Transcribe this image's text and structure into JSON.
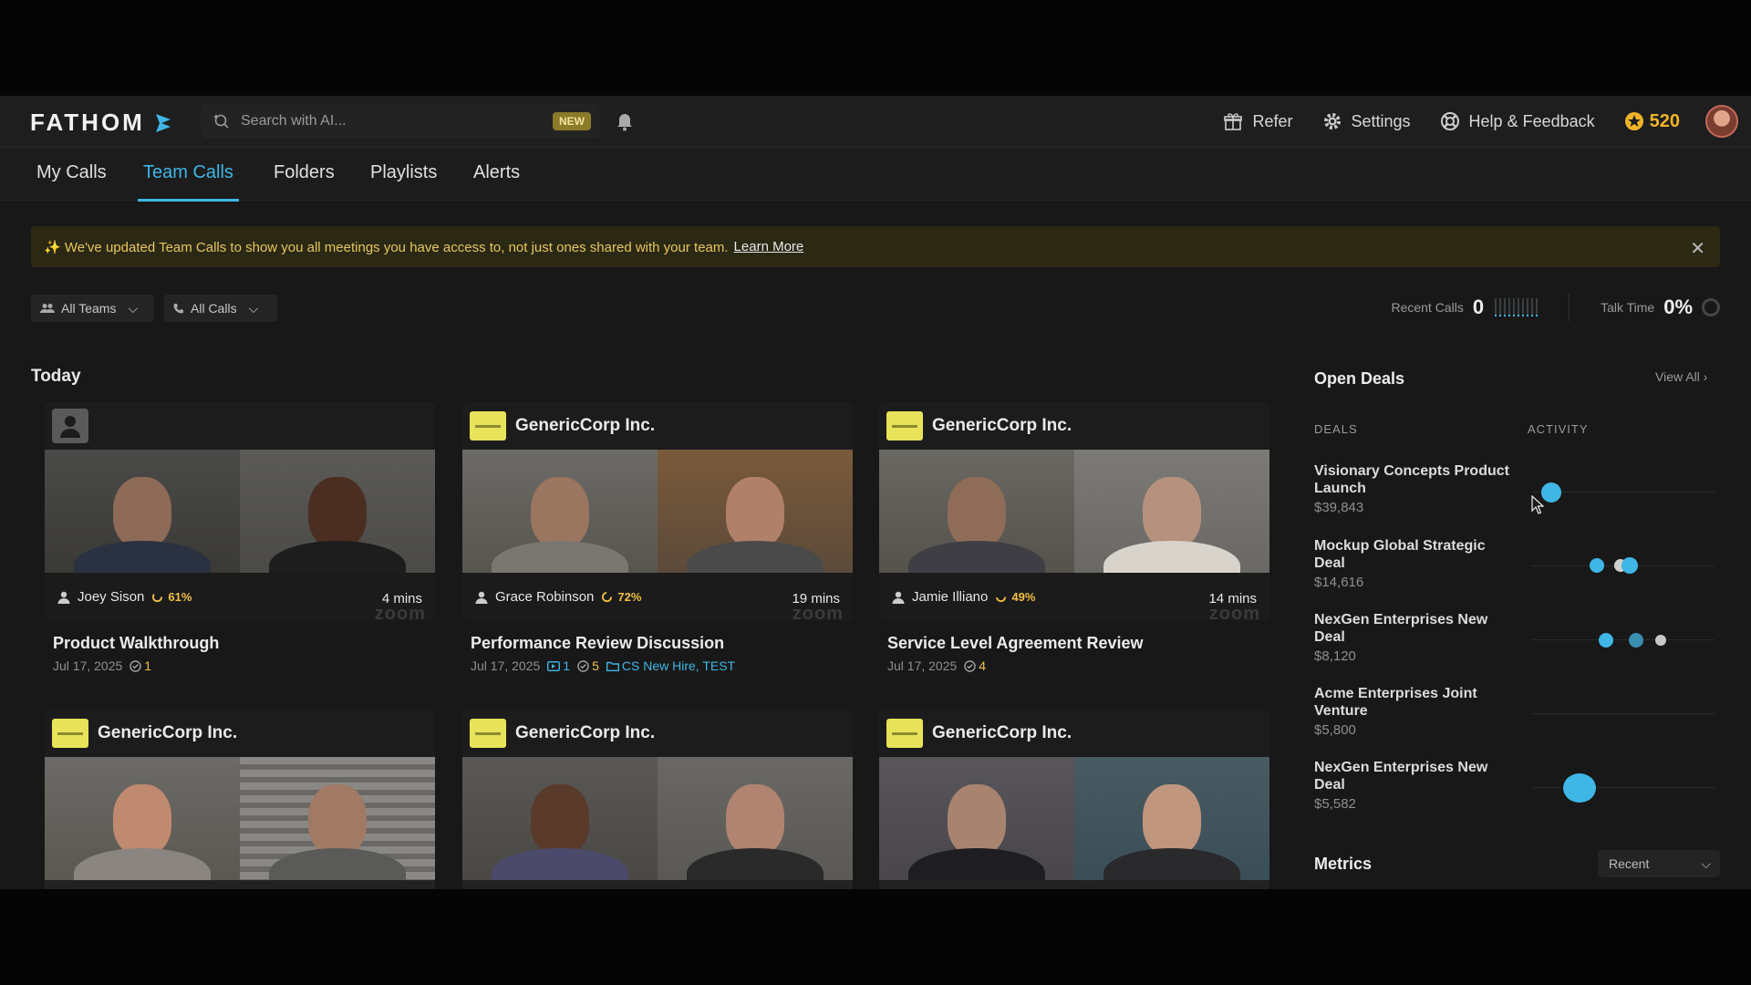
{
  "header": {
    "logo": "FATHOM",
    "search_placeholder": "Search with AI...",
    "new_badge": "NEW",
    "refer": "Refer",
    "settings": "Settings",
    "help": "Help & Feedback",
    "points": "520"
  },
  "tabs": [
    "My Calls",
    "Team Calls",
    "Folders",
    "Playlists",
    "Alerts"
  ],
  "active_tab": "Team Calls",
  "banner": {
    "text": "✨ We've updated Team Calls to show you all meetings you have access to, not just ones shared with your team.",
    "link": "Learn More"
  },
  "filters": {
    "teams": "All Teams",
    "calls": "All Calls"
  },
  "stats": {
    "recent_calls_label": "Recent Calls",
    "recent_calls_value": "0",
    "talk_time_label": "Talk Time",
    "talk_time_value": "0%"
  },
  "section_today": "Today",
  "cards": [
    {
      "company": "",
      "host": "Joey Sison",
      "score": "61%",
      "duration": "4 mins",
      "title": "Product Walkthrough",
      "date": "Jul 17, 2025",
      "clips": "",
      "actions": "1",
      "folders": "",
      "zoom": "zoom"
    },
    {
      "company": "GenericCorp Inc.",
      "host": "Grace Robinson",
      "score": "72%",
      "duration": "19 mins",
      "title": "Performance Review Discussion",
      "date": "Jul 17, 2025",
      "clips": "1",
      "actions": "5",
      "folders": "CS New Hire, TEST",
      "zoom": "zoom"
    },
    {
      "company": "GenericCorp Inc.",
      "host": "Jamie Illiano",
      "score": "49%",
      "duration": "14 mins",
      "title": "Service Level Agreement Review",
      "date": "Jul 17, 2025",
      "clips": "",
      "actions": "4",
      "folders": "",
      "zoom": "zoom"
    },
    {
      "company": "GenericCorp Inc."
    },
    {
      "company": "GenericCorp Inc."
    },
    {
      "company": "GenericCorp Inc."
    }
  ],
  "deals_panel": {
    "title": "Open Deals",
    "view_all": "View All",
    "col_deals": "DEALS",
    "col_activity": "ACTIVITY",
    "deals": [
      {
        "name": "Visionary Concepts Product Launch",
        "amount": "$39,843"
      },
      {
        "name": "Mockup Global Strategic Deal",
        "amount": "$14,616"
      },
      {
        "name": "NexGen Enterprises New Deal",
        "amount": "$8,120"
      },
      {
        "name": "Acme Enterprises Joint Venture",
        "amount": "$5,800"
      },
      {
        "name": "NexGen Enterprises New Deal",
        "amount": "$5,582"
      }
    ]
  },
  "metrics": {
    "title": "Metrics",
    "range": "Recent"
  },
  "colors": {
    "accent": "#3fb6e6",
    "gold": "#f0b429",
    "company_logo": "#e8e35a"
  }
}
